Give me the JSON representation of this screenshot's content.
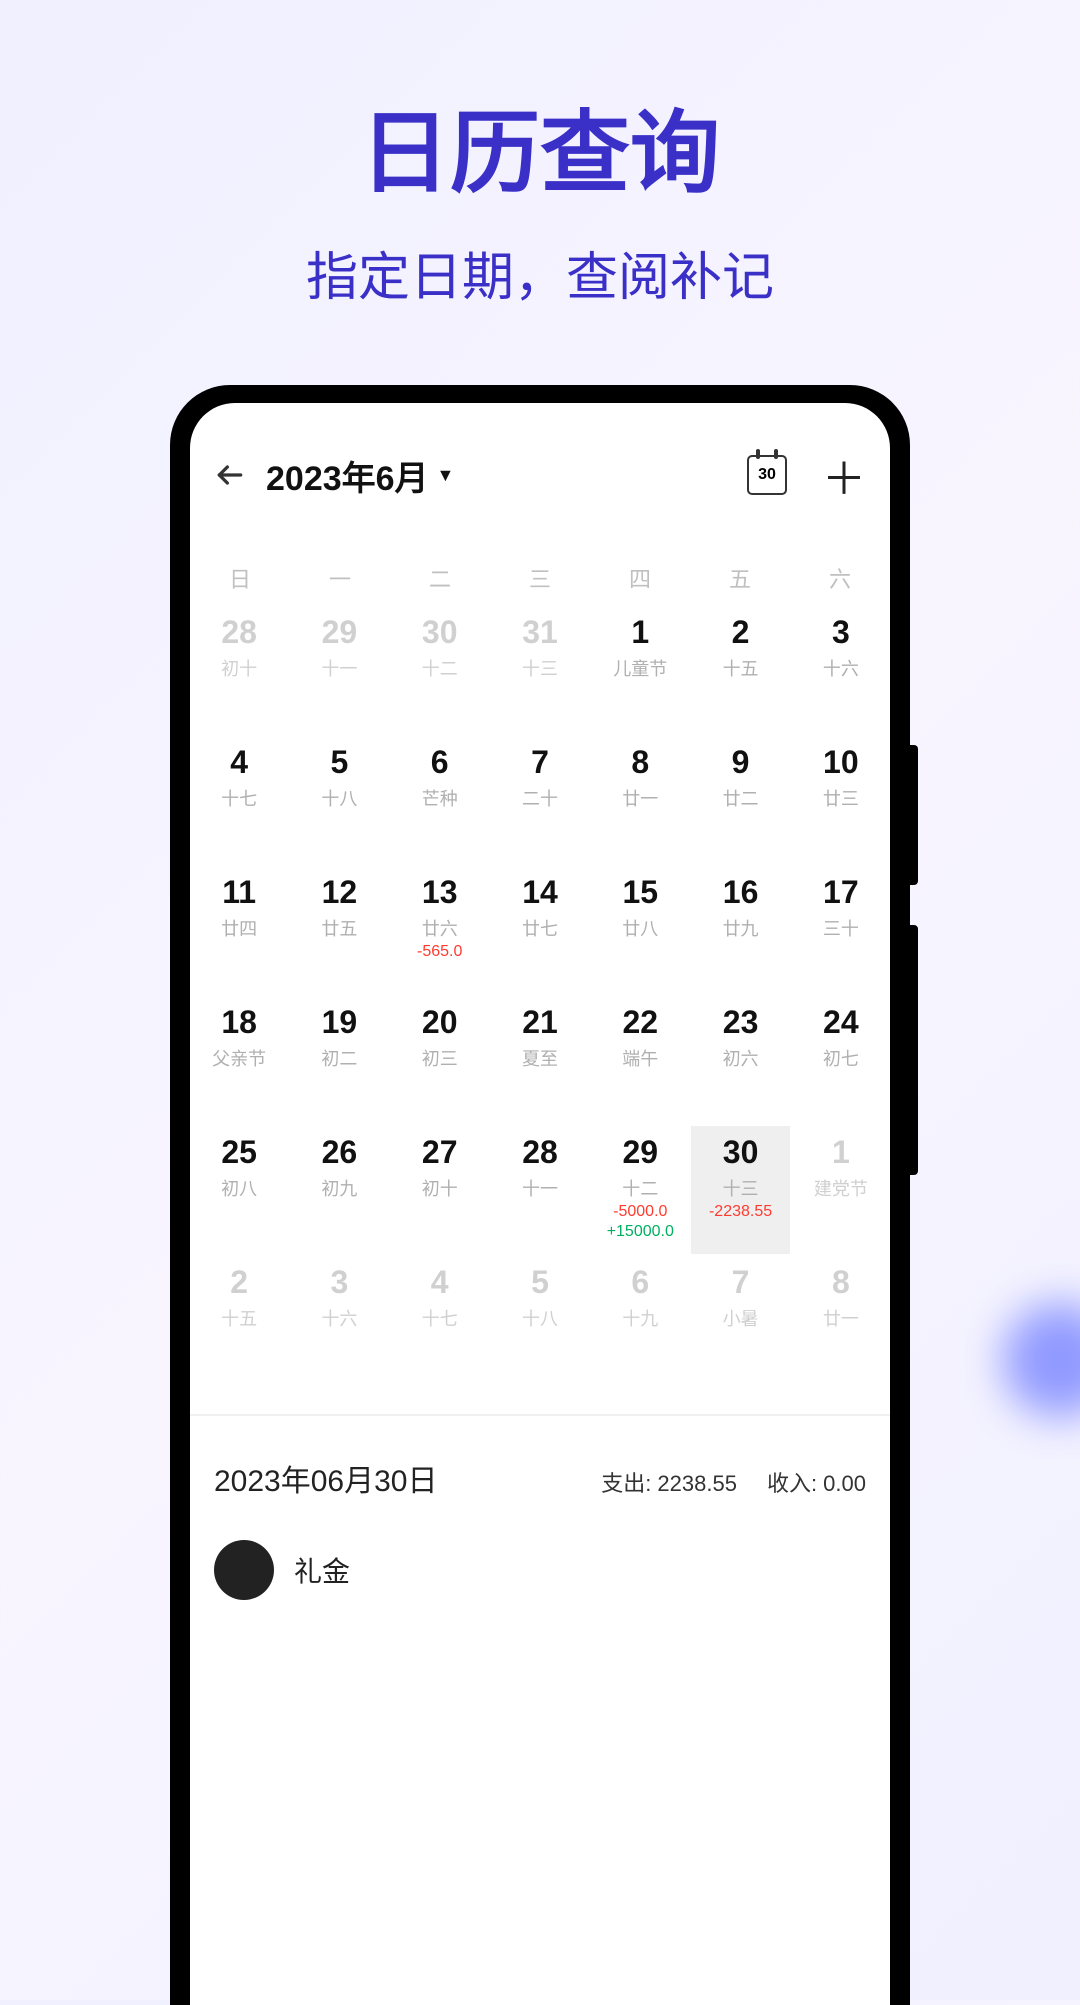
{
  "promo": {
    "title": "日历查询",
    "subtitle": "指定日期，查阅补记"
  },
  "header": {
    "month_label": "2023年6月",
    "today_badge": "30"
  },
  "weekdays": [
    "日",
    "一",
    "二",
    "三",
    "四",
    "五",
    "六"
  ],
  "cells": [
    {
      "day": "28",
      "lunar": "初十",
      "dim": true
    },
    {
      "day": "29",
      "lunar": "十一",
      "dim": true
    },
    {
      "day": "30",
      "lunar": "十二",
      "dim": true
    },
    {
      "day": "31",
      "lunar": "十三",
      "dim": true
    },
    {
      "day": "1",
      "lunar": "儿童节"
    },
    {
      "day": "2",
      "lunar": "十五"
    },
    {
      "day": "3",
      "lunar": "十六"
    },
    {
      "day": "4",
      "lunar": "十七"
    },
    {
      "day": "5",
      "lunar": "十八"
    },
    {
      "day": "6",
      "lunar": "芒种"
    },
    {
      "day": "7",
      "lunar": "二十"
    },
    {
      "day": "8",
      "lunar": "廿一"
    },
    {
      "day": "9",
      "lunar": "廿二"
    },
    {
      "day": "10",
      "lunar": "廿三"
    },
    {
      "day": "11",
      "lunar": "廿四"
    },
    {
      "day": "12",
      "lunar": "廿五"
    },
    {
      "day": "13",
      "lunar": "廿六",
      "neg": "-565.0"
    },
    {
      "day": "14",
      "lunar": "廿七"
    },
    {
      "day": "15",
      "lunar": "廿八"
    },
    {
      "day": "16",
      "lunar": "廿九"
    },
    {
      "day": "17",
      "lunar": "三十"
    },
    {
      "day": "18",
      "lunar": "父亲节"
    },
    {
      "day": "19",
      "lunar": "初二"
    },
    {
      "day": "20",
      "lunar": "初三"
    },
    {
      "day": "21",
      "lunar": "夏至"
    },
    {
      "day": "22",
      "lunar": "端午"
    },
    {
      "day": "23",
      "lunar": "初六"
    },
    {
      "day": "24",
      "lunar": "初七"
    },
    {
      "day": "25",
      "lunar": "初八"
    },
    {
      "day": "26",
      "lunar": "初九"
    },
    {
      "day": "27",
      "lunar": "初十"
    },
    {
      "day": "28",
      "lunar": "十一"
    },
    {
      "day": "29",
      "lunar": "十二",
      "neg": "-5000.0",
      "pos": "+15000.0"
    },
    {
      "day": "30",
      "lunar": "十三",
      "neg": "-2238.55",
      "selected": true
    },
    {
      "day": "1",
      "lunar": "建党节",
      "dim": true
    },
    {
      "day": "2",
      "lunar": "十五",
      "dim": true
    },
    {
      "day": "3",
      "lunar": "十六",
      "dim": true
    },
    {
      "day": "4",
      "lunar": "十七",
      "dim": true
    },
    {
      "day": "5",
      "lunar": "十八",
      "dim": true
    },
    {
      "day": "6",
      "lunar": "十九",
      "dim": true
    },
    {
      "day": "7",
      "lunar": "小暑",
      "dim": true
    },
    {
      "day": "8",
      "lunar": "廿一",
      "dim": true
    }
  ],
  "summary": {
    "date_label": "2023年06月30日",
    "expense_label": "支出: 2238.55",
    "income_label": "收入: 0.00"
  },
  "entry": {
    "label": "礼金"
  }
}
